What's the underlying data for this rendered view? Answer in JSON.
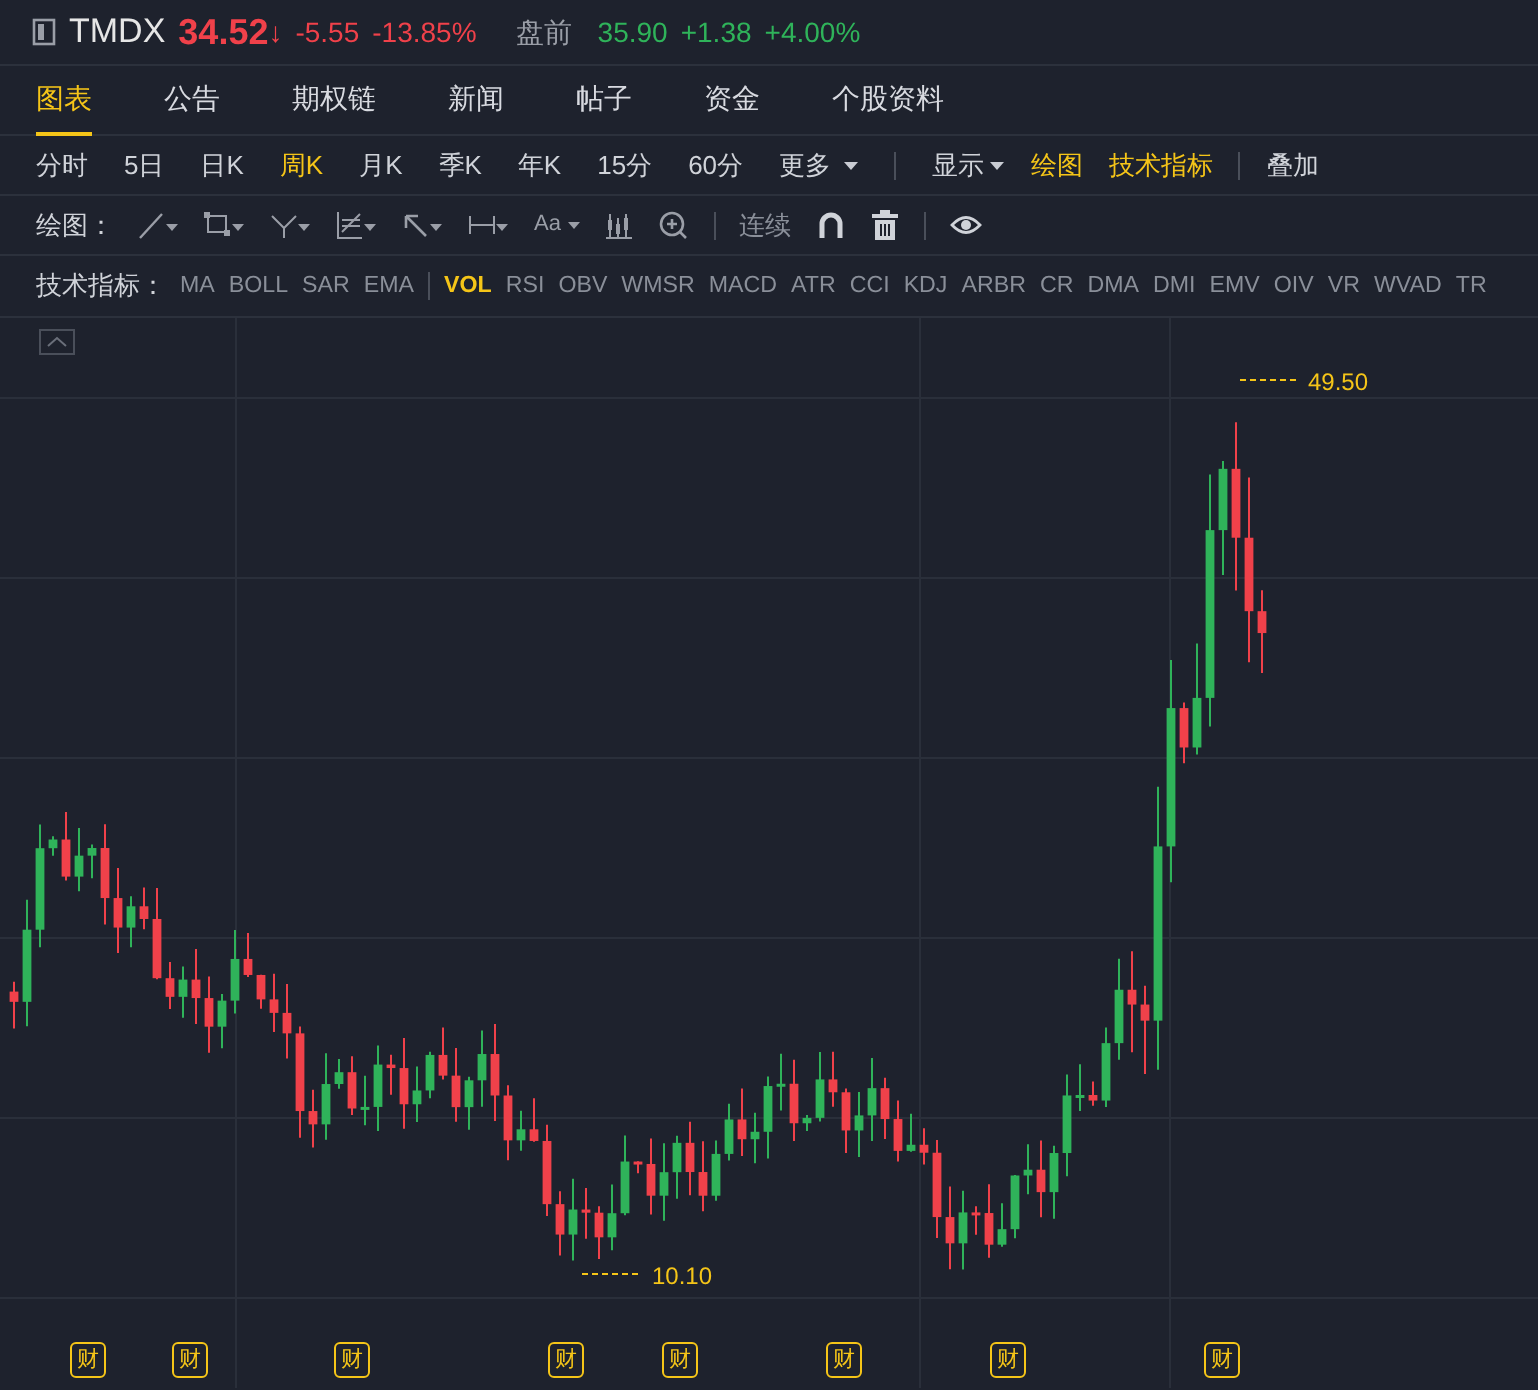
{
  "quote": {
    "symbol": "TMDX",
    "price": "34.52",
    "arrow": "↓",
    "change": "-5.55",
    "change_pct": "-13.85%",
    "session_label": "盘前",
    "session_price": "35.90",
    "session_change": "+1.38",
    "session_change_pct": "+4.00%"
  },
  "tabs": [
    {
      "label": "图表",
      "selected": true
    },
    {
      "label": "公告",
      "selected": false
    },
    {
      "label": "期权链",
      "selected": false
    },
    {
      "label": "新闻",
      "selected": false
    },
    {
      "label": "帖子",
      "selected": false
    },
    {
      "label": "资金",
      "selected": false
    },
    {
      "label": "个股资料",
      "selected": false
    }
  ],
  "periods": [
    {
      "label": "分时",
      "selected": false
    },
    {
      "label": "5日",
      "selected": false
    },
    {
      "label": "日K",
      "selected": false
    },
    {
      "label": "周K",
      "selected": true
    },
    {
      "label": "月K",
      "selected": false
    },
    {
      "label": "季K",
      "selected": false
    },
    {
      "label": "年K",
      "selected": false
    },
    {
      "label": "15分",
      "selected": false
    },
    {
      "label": "60分",
      "selected": false
    }
  ],
  "more_menu": "更多",
  "view_options": [
    {
      "label": "显示",
      "kind": "dropdown",
      "on": false
    },
    {
      "label": "绘图",
      "kind": "toggle",
      "on": true
    },
    {
      "label": "技术指标",
      "kind": "toggle",
      "on": true
    },
    {
      "label": "叠加",
      "kind": "separated",
      "on": false
    }
  ],
  "drawing_label": "绘图：",
  "drawing_tools": [
    {
      "kind": "line"
    },
    {
      "kind": "rect"
    },
    {
      "kind": "fork"
    },
    {
      "kind": "fib"
    },
    {
      "kind": "arrow"
    },
    {
      "kind": "measure"
    },
    {
      "kind": "text",
      "label": "Aa"
    },
    {
      "kind": "candles"
    },
    {
      "kind": "zoom"
    },
    {
      "kind": "sep"
    },
    {
      "kind": "continuous",
      "label": "连续"
    },
    {
      "kind": "magnet"
    },
    {
      "kind": "trash"
    },
    {
      "kind": "sep"
    },
    {
      "kind": "eye"
    }
  ],
  "indicator_label": "技术指标：",
  "overlay_indicators": [
    "MA",
    "BOLL",
    "SAR",
    "EMA"
  ],
  "indicators": [
    {
      "label": "VOL",
      "selected": true
    },
    {
      "label": "RSI",
      "selected": false
    },
    {
      "label": "OBV",
      "selected": false
    },
    {
      "label": "WMSR",
      "selected": false
    },
    {
      "label": "MACD",
      "selected": false
    },
    {
      "label": "ATR",
      "selected": false
    },
    {
      "label": "CCI",
      "selected": false
    },
    {
      "label": "KDJ",
      "selected": false
    },
    {
      "label": "ARBR",
      "selected": false
    },
    {
      "label": "CR",
      "selected": false
    },
    {
      "label": "DMA",
      "selected": false
    },
    {
      "label": "DMI",
      "selected": false
    },
    {
      "label": "EMV",
      "selected": false
    },
    {
      "label": "OIV",
      "selected": false
    },
    {
      "label": "VR",
      "selected": false
    },
    {
      "label": "WVAD",
      "selected": false
    },
    {
      "label": "TR",
      "selected": false
    }
  ],
  "chart": {
    "high_label": "49.50",
    "low_label": "10.10",
    "earnings_markers": [
      "财",
      "财",
      "财",
      "财",
      "财",
      "财",
      "财",
      "财"
    ]
  }
}
